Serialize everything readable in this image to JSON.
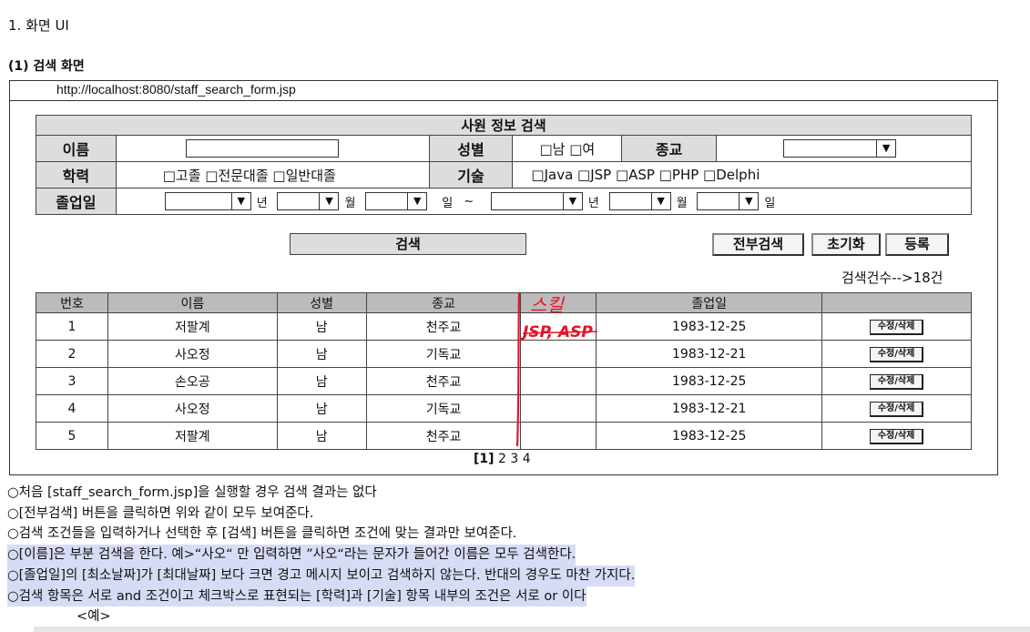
{
  "doc": {
    "section_title": "1. 화면 UI",
    "subsection_title": "(1) 검색 화면"
  },
  "browser": {
    "url": "http://localhost:8080/staff_search_form.jsp"
  },
  "search_form": {
    "title": "사원 정보 검색",
    "labels": {
      "name": "이름",
      "gender": "성별",
      "religion": "종교",
      "education": "학력",
      "skills": "기술",
      "graduation": "졸업일"
    },
    "name_value": "",
    "gender_options": "□남 □여",
    "religion_selected": "",
    "education_options": "□고졸 □전문대졸 □일반대졸",
    "skill_options": "□Java □JSP □ASP □PHP □Delphi",
    "date_units": {
      "year": "년",
      "month": "월",
      "day": "일",
      "tilde": "~"
    },
    "dropdown_arrow": "▼",
    "buttons": {
      "search": "검색",
      "search_all": "전부검색",
      "reset": "초기화",
      "register": "등록"
    },
    "result_count": "검색건수-->18건"
  },
  "results": {
    "headers": [
      "번호",
      "이름",
      "성별",
      "종교",
      "",
      "졸업일",
      ""
    ],
    "action_label": "수정/삭제",
    "rows": [
      {
        "no": "1",
        "name": "저팔계",
        "gender": "남",
        "religion": "천주교",
        "skill": "",
        "grad": "1983-12-25"
      },
      {
        "no": "2",
        "name": "사오정",
        "gender": "남",
        "religion": "기독교",
        "skill": "",
        "grad": "1983-12-21"
      },
      {
        "no": "3",
        "name": "손오공",
        "gender": "남",
        "religion": "천주교",
        "skill": "",
        "grad": "1983-12-25"
      },
      {
        "no": "4",
        "name": "사오정",
        "gender": "남",
        "religion": "기독교",
        "skill": "",
        "grad": "1983-12-21"
      },
      {
        "no": "5",
        "name": "저팔계",
        "gender": "남",
        "religion": "천주교",
        "skill": "",
        "grad": "1983-12-25"
      }
    ],
    "pagination": {
      "current": "[1]",
      "others": "2 3 4"
    }
  },
  "annotation": {
    "header": "스킬",
    "example": "JSP, ASP",
    "color": "#e0152a"
  },
  "notes": [
    "○처음 [staff_search_form.jsp]을 실행할 경우 검색 결과는 없다",
    "○[전부검색] 버튼을 클릭하면 위와 같이 모두 보여준다.",
    "○검색 조건들을 입력하거나 선택한 후 [검색] 버튼을 클릭하면 조건에 맞는 결과만 보여준다.",
    "○[이름]은 부분 검색을 한다. 예>“사오“ 만 입력하면 ”사오“라는 문자가 들어간 이름은 모두 검색한다.",
    "○[졸업일]의 [최소날짜]가 [최대날짜] 보다 크면 경고 메시지 보이고 검색하지 않는다. 반대의 경우도 마찬 가지다.",
    "○검색 항목은 서로 and 조건이고 체크박스로 표현되는 [학력]과 [기술] 항목 내부의 조건은 서로 or 이다"
  ],
  "example_label": "<예>",
  "colors": {
    "header_bg": "#dddddd",
    "table_header_bg": "#bbbbbb",
    "highlight": "#d6dcf5"
  }
}
